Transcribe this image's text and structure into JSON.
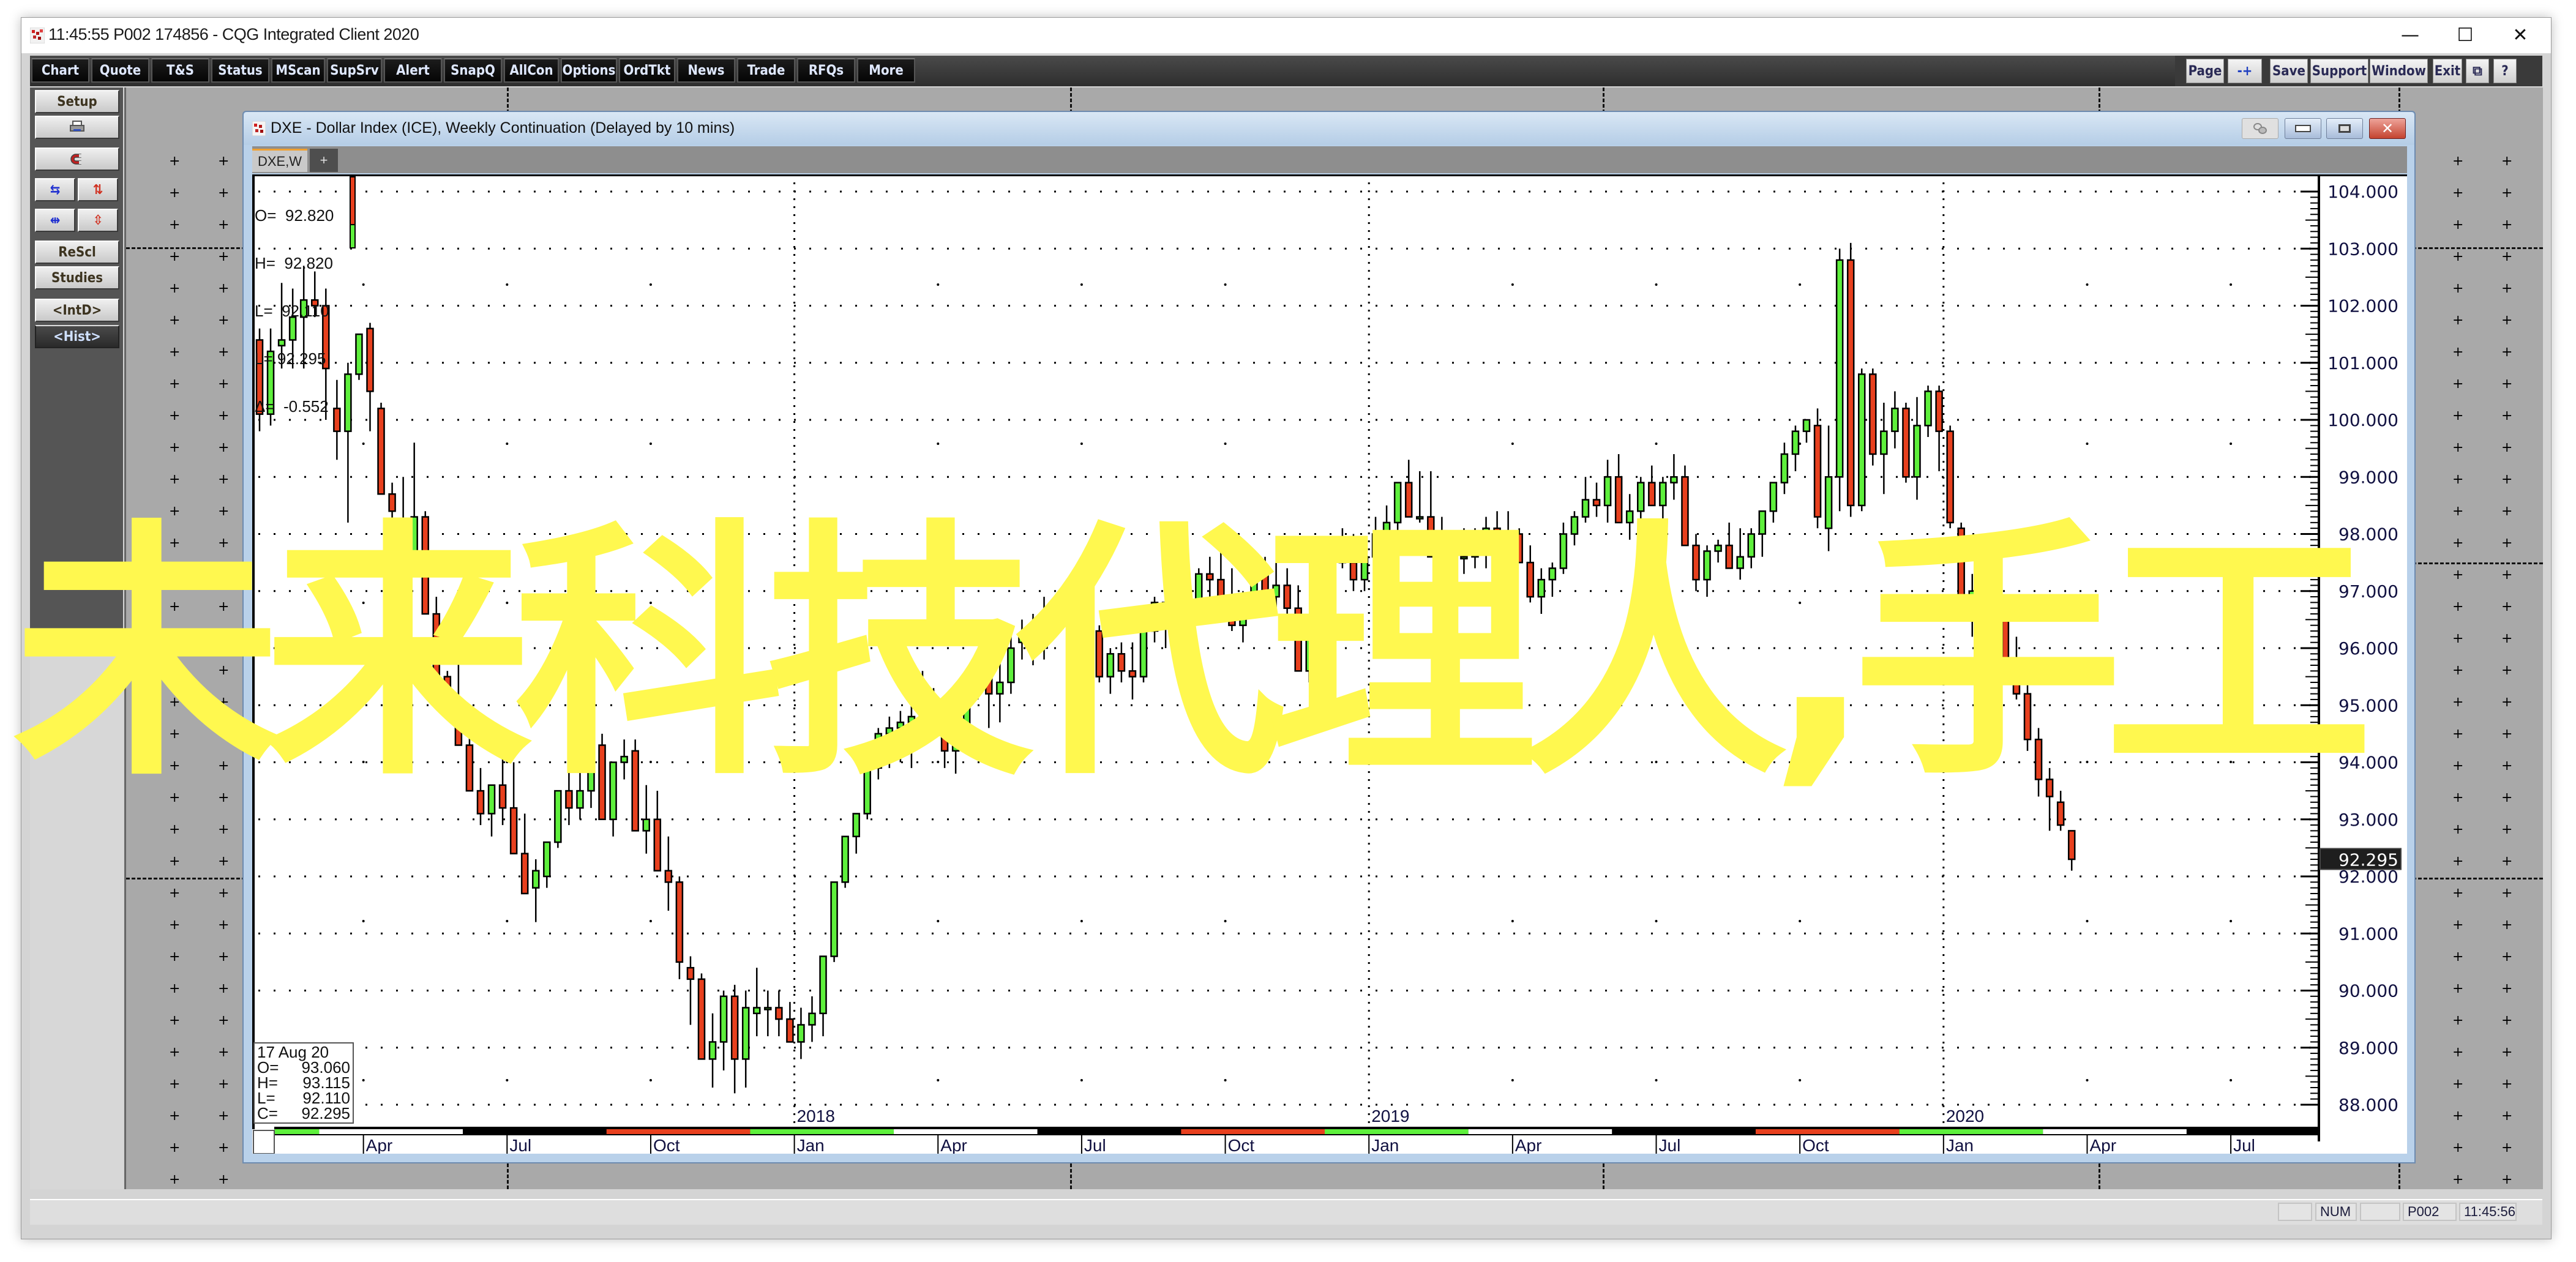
{
  "window": {
    "title": "11:45:55   P002   174856 - CQG Integrated Client 2020",
    "controls": {
      "minimize": "—",
      "maximize": "☐",
      "close": "✕"
    }
  },
  "toolbar": {
    "left_buttons": [
      "Chart",
      "Quote",
      "T&S",
      "Status",
      "MScan",
      "SupSrv",
      "Alert",
      "SnapQ",
      "AllCon",
      "Options",
      "OrdTkt",
      "News",
      "Trade",
      "RFQs",
      "More"
    ],
    "right_buttons": [
      "Page",
      "-+",
      "Save",
      "Support",
      "Window",
      "Exit",
      "⧉",
      "?"
    ]
  },
  "left_panel": {
    "setup": "Setup",
    "print_icon": "printer-icon",
    "magnet_icon": "magnet-icon",
    "row1": [
      "⇆",
      "⇅"
    ],
    "row2": [
      "⇹",
      "⇳"
    ],
    "rescale": "ReScl",
    "studies": "Studies",
    "intd": "<IntD>",
    "hist": "<Hist>"
  },
  "chart_window": {
    "title": "DXE - Dollar Index (ICE), Weekly Continuation (Delayed by 10 mins)",
    "tabs": [
      {
        "label": "DXE,W",
        "active": true
      },
      {
        "label": "+",
        "active": false
      }
    ],
    "ohlc_header": {
      "O": "92.820",
      "H": "92.820",
      "L": "92.110",
      "C_label": "L=",
      "C": "92.295",
      "delta": "-0.552"
    },
    "hover_box": {
      "date": "17  Aug  20",
      "O": "93.060",
      "H": "93.115",
      "L": "92.110",
      "C": "92.295"
    },
    "last_price": "92.295"
  },
  "overlay_text": "未来科技代理人,手工",
  "status_bar": {
    "box1": "",
    "num": "NUM",
    "box3": "",
    "page": "P002",
    "time": "11:45:56"
  },
  "colors": {
    "up": "#5ef03c",
    "down": "#e8401e",
    "overlay": "#fff84f",
    "axis_text": "#101040"
  },
  "chart_data": {
    "type": "candlestick",
    "title": "DXE - Dollar Index (ICE), Weekly Continuation",
    "xlabel": "",
    "ylabel": "",
    "ylim": [
      88.0,
      104.0
    ],
    "y_ticks": [
      "104.000",
      "103.000",
      "102.000",
      "101.000",
      "100.000",
      "99.000",
      "98.000",
      "97.000",
      "96.000",
      "95.000",
      "94.000",
      "93.000",
      "92.000",
      "91.000",
      "90.000",
      "89.000",
      "88.000"
    ],
    "year_labels": [
      "2018",
      "2019",
      "2020"
    ],
    "month_labels": [
      "Apr",
      "Jul",
      "Oct",
      "Jan",
      "Apr",
      "Jul",
      "Oct",
      "Jan",
      "Apr",
      "Jul",
      "Oct",
      "Jan",
      "Apr",
      "Jul"
    ],
    "grid": true,
    "candles": [
      [
        101.4,
        101.6,
        99.8,
        100.1
      ],
      [
        100.1,
        101.6,
        99.9,
        101.2
      ],
      [
        101.3,
        102.4,
        100.9,
        101.4
      ],
      [
        101.4,
        102.3,
        100.9,
        101.8
      ],
      [
        101.8,
        102.7,
        100.9,
        102.1
      ],
      [
        102.1,
        102.6,
        101.8,
        102.0
      ],
      [
        102.0,
        102.3,
        100.0,
        100.9
      ],
      [
        100.2,
        100.7,
        99.3,
        99.8
      ],
      [
        99.8,
        101.0,
        98.2,
        100.8
      ],
      [
        100.8,
        101.2,
        100.7,
        101.5
      ],
      [
        101.6,
        101.7,
        99.8,
        100.5
      ],
      [
        100.2,
        100.3,
        98.8,
        98.7
      ],
      [
        98.7,
        98.9,
        97.7,
        98.4
      ],
      [
        98.0,
        99.0,
        97.3,
        97.5
      ],
      [
        97.5,
        99.6,
        97.5,
        98.3
      ],
      [
        98.3,
        98.4,
        96.8,
        96.6
      ],
      [
        96.6,
        96.9,
        95.9,
        95.5
      ],
      [
        95.5,
        95.6,
        94.9,
        95.0
      ],
      [
        95.0,
        96.0,
        94.5,
        94.3
      ],
      [
        94.3,
        94.6,
        93.6,
        93.5
      ],
      [
        93.5,
        93.9,
        92.9,
        93.1
      ],
      [
        93.1,
        93.6,
        92.7,
        93.6
      ],
      [
        93.6,
        94.1,
        92.9,
        93.2
      ],
      [
        93.2,
        94.0,
        92.7,
        92.4
      ],
      [
        92.4,
        93.1,
        91.9,
        91.7
      ],
      [
        91.8,
        92.3,
        91.2,
        92.1
      ],
      [
        92.0,
        92.6,
        91.8,
        92.6
      ],
      [
        92.6,
        93.1,
        92.5,
        93.5
      ],
      [
        93.5,
        94.0,
        92.9,
        93.2
      ],
      [
        93.2,
        94.1,
        93.0,
        93.5
      ],
      [
        93.5,
        94.8,
        93.2,
        94.3
      ],
      [
        94.3,
        94.5,
        93.0,
        93.0
      ],
      [
        93.0,
        93.9,
        92.7,
        94.0
      ],
      [
        94.0,
        94.4,
        93.7,
        94.1
      ],
      [
        94.2,
        94.4,
        93.0,
        92.8
      ],
      [
        92.8,
        93.6,
        92.4,
        93.0
      ],
      [
        93.0,
        93.5,
        92.3,
        92.1
      ],
      [
        92.1,
        92.7,
        91.4,
        91.9
      ],
      [
        91.9,
        92.0,
        90.2,
        90.5
      ],
      [
        90.4,
        90.6,
        89.4,
        90.2
      ],
      [
        90.2,
        90.3,
        88.9,
        88.8
      ],
      [
        88.8,
        89.6,
        88.3,
        89.1
      ],
      [
        89.1,
        90.0,
        88.6,
        89.9
      ],
      [
        89.9,
        90.1,
        88.2,
        88.8
      ],
      [
        88.8,
        90.0,
        88.3,
        89.7
      ],
      [
        89.6,
        90.4,
        89.2,
        89.7
      ],
      [
        89.7,
        90.0,
        89.2,
        89.7
      ],
      [
        89.7,
        90.0,
        89.2,
        89.5
      ],
      [
        89.5,
        89.8,
        89.1,
        89.1
      ],
      [
        89.1,
        89.7,
        88.8,
        89.4
      ],
      [
        89.4,
        89.9,
        89.1,
        89.6
      ],
      [
        89.6,
        90.5,
        89.2,
        90.6
      ],
      [
        90.6,
        91.1,
        90.5,
        91.9
      ],
      [
        91.9,
        92.7,
        91.8,
        92.7
      ],
      [
        92.7,
        93.1,
        92.4,
        93.1
      ],
      [
        93.1,
        93.6,
        93.0,
        93.9
      ],
      [
        93.9,
        94.6,
        93.7,
        94.5
      ],
      [
        94.5,
        94.8,
        93.9,
        94.6
      ],
      [
        94.6,
        94.9,
        94.0,
        94.7
      ],
      [
        94.7,
        95.0,
        93.9,
        94.8
      ],
      [
        94.8,
        95.6,
        94.6,
        95.0
      ],
      [
        95.0,
        95.3,
        94.7,
        94.6
      ],
      [
        94.6,
        94.9,
        93.9,
        94.2
      ],
      [
        94.2,
        95.0,
        93.8,
        94.6
      ],
      [
        94.6,
        95.5,
        94.4,
        95.3
      ],
      [
        95.3,
        95.7,
        95.1,
        95.6
      ],
      [
        95.6,
        95.8,
        94.6,
        95.2
      ],
      [
        95.2,
        95.8,
        94.7,
        95.4
      ],
      [
        95.4,
        96.4,
        95.2,
        96.0
      ],
      [
        96.1,
        96.5,
        95.8,
        96.2
      ],
      [
        96.2,
        96.6,
        95.7,
        96.0
      ],
      [
        96.0,
        96.9,
        95.8,
        96.4
      ],
      [
        96.4,
        96.9,
        96.2,
        96.6
      ],
      [
        96.6,
        97.0,
        96.5,
        96.9
      ],
      [
        96.9,
        97.2,
        96.4,
        96.9
      ],
      [
        96.9,
        97.2,
        96.2,
        96.3
      ],
      [
        96.3,
        96.4,
        95.4,
        95.5
      ],
      [
        95.5,
        96.0,
        95.2,
        95.9
      ],
      [
        95.9,
        96.1,
        95.4,
        95.6
      ],
      [
        95.6,
        96.1,
        95.1,
        95.5
      ],
      [
        95.5,
        96.2,
        95.4,
        96.3
      ],
      [
        96.3,
        96.9,
        96.1,
        96.8
      ],
      [
        96.8,
        97.0,
        96.0,
        96.4
      ],
      [
        96.4,
        96.9,
        95.9,
        96.3
      ],
      [
        96.3,
        97.0,
        96.1,
        96.6
      ],
      [
        96.6,
        97.4,
        96.5,
        97.3
      ],
      [
        97.3,
        97.6,
        96.8,
        97.2
      ],
      [
        97.2,
        97.7,
        96.9,
        96.9
      ],
      [
        96.9,
        97.4,
        96.3,
        96.4
      ],
      [
        96.4,
        97.0,
        96.1,
        96.7
      ],
      [
        96.7,
        97.4,
        96.6,
        97.4
      ],
      [
        97.4,
        97.6,
        97.0,
        96.9
      ],
      [
        96.9,
        97.5,
        96.7,
        97.1
      ],
      [
        97.1,
        97.4,
        96.6,
        96.7
      ],
      [
        96.7,
        97.1,
        96.2,
        95.6
      ],
      [
        95.6,
        96.4,
        95.4,
        96.5
      ],
      [
        96.5,
        97.2,
        96.3,
        97.3
      ],
      [
        97.3,
        97.6,
        97.0,
        97.7
      ],
      [
        97.7,
        98.1,
        97.4,
        97.5
      ],
      [
        97.5,
        98.0,
        97.0,
        97.2
      ],
      [
        97.2,
        97.8,
        97.0,
        97.6
      ],
      [
        97.6,
        98.3,
        97.5,
        98.0
      ],
      [
        98.0,
        98.5,
        97.7,
        98.2
      ],
      [
        98.2,
        98.9,
        97.7,
        98.9
      ],
      [
        98.9,
        99.3,
        98.4,
        98.3
      ],
      [
        98.3,
        99.1,
        98.2,
        98.3
      ],
      [
        98.3,
        99.1,
        98.0,
        97.6
      ],
      [
        97.6,
        98.3,
        97.3,
        97.1
      ],
      [
        97.1,
        97.4,
        96.6,
        97.6
      ],
      [
        97.6,
        98.1,
        97.3,
        97.6
      ],
      [
        97.6,
        98.1,
        97.4,
        97.8
      ],
      [
        97.8,
        98.3,
        97.4,
        98.1
      ],
      [
        98.1,
        98.4,
        97.5,
        97.9
      ],
      [
        97.9,
        98.4,
        97.6,
        98.0
      ],
      [
        98.0,
        98.1,
        97.5,
        97.5
      ],
      [
        97.5,
        97.8,
        96.8,
        96.9
      ],
      [
        96.9,
        97.4,
        96.6,
        97.2
      ],
      [
        97.2,
        97.5,
        96.9,
        97.4
      ],
      [
        97.4,
        98.2,
        97.3,
        98.0
      ],
      [
        98.0,
        98.4,
        97.8,
        98.3
      ],
      [
        98.3,
        99.0,
        98.2,
        98.6
      ],
      [
        98.6,
        98.9,
        98.3,
        98.5
      ],
      [
        98.5,
        99.3,
        98.2,
        99.0
      ],
      [
        99.0,
        99.4,
        98.7,
        98.2
      ],
      [
        98.2,
        98.7,
        97.9,
        98.4
      ],
      [
        98.4,
        99.0,
        98.2,
        98.9
      ],
      [
        98.9,
        99.2,
        98.5,
        98.5
      ],
      [
        98.5,
        99.0,
        98.2,
        98.9
      ],
      [
        98.9,
        99.4,
        98.6,
        99.0
      ],
      [
        99.0,
        99.2,
        97.9,
        97.8
      ],
      [
        97.8,
        98.0,
        97.0,
        97.2
      ],
      [
        97.2,
        97.8,
        96.9,
        97.7
      ],
      [
        97.7,
        97.9,
        97.5,
        97.8
      ],
      [
        97.8,
        98.2,
        97.5,
        97.4
      ],
      [
        97.4,
        98.1,
        97.2,
        97.6
      ],
      [
        97.6,
        98.1,
        97.4,
        98.0
      ],
      [
        98.0,
        98.4,
        97.6,
        98.4
      ],
      [
        98.4,
        98.9,
        98.2,
        98.9
      ],
      [
        98.9,
        99.6,
        98.7,
        99.4
      ],
      [
        99.4,
        99.9,
        99.1,
        99.8
      ],
      [
        99.8,
        100.0,
        99.6,
        100.0
      ],
      [
        99.9,
        100.2,
        98.1,
        98.3
      ],
      [
        98.1,
        99.9,
        97.7,
        99.0
      ],
      [
        99.0,
        103.0,
        98.4,
        102.8
      ],
      [
        102.8,
        103.1,
        98.3,
        98.5
      ],
      [
        98.5,
        100.9,
        98.4,
        100.8
      ],
      [
        100.8,
        100.9,
        99.2,
        99.4
      ],
      [
        99.4,
        100.3,
        98.7,
        99.8
      ],
      [
        99.8,
        100.5,
        99.5,
        100.2
      ],
      [
        100.2,
        100.3,
        98.9,
        99.0
      ],
      [
        99.0,
        100.4,
        98.6,
        99.9
      ],
      [
        99.9,
        100.6,
        99.7,
        100.5
      ],
      [
        100.5,
        100.6,
        99.1,
        99.8
      ],
      [
        99.8,
        99.9,
        98.1,
        98.2
      ],
      [
        98.1,
        98.2,
        96.8,
        96.8
      ],
      [
        96.8,
        97.3,
        96.2,
        97.0
      ],
      [
        97.0,
        97.5,
        96.2,
        96.9
      ],
      [
        96.9,
        97.3,
        95.7,
        96.7
      ],
      [
        96.7,
        96.9,
        95.6,
        95.7
      ],
      [
        95.7,
        96.2,
        95.1,
        95.2
      ],
      [
        95.2,
        95.4,
        94.2,
        94.4
      ],
      [
        94.4,
        94.6,
        93.4,
        93.7
      ],
      [
        93.7,
        93.9,
        92.8,
        93.4
      ],
      [
        93.3,
        93.5,
        92.8,
        92.9
      ],
      [
        92.8,
        92.8,
        92.1,
        92.3
      ]
    ]
  }
}
